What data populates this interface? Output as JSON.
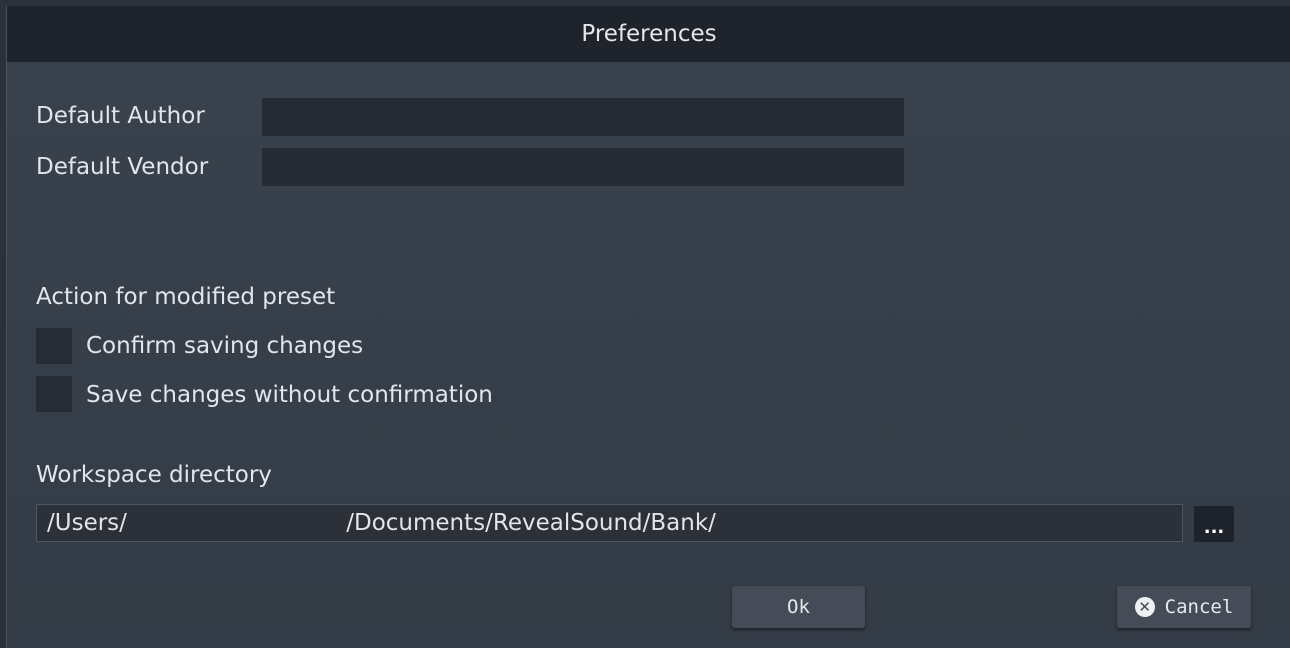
{
  "dialog": {
    "title": "Preferences"
  },
  "fields": {
    "author_label": "Default Author",
    "author_value": "",
    "vendor_label": "Default Vendor",
    "vendor_value": ""
  },
  "modified_preset": {
    "heading": "Action for modified preset",
    "option_confirm": "Confirm saving changes",
    "option_confirm_checked": false,
    "option_auto_save": "Save changes without confirmation",
    "option_auto_save_checked": false
  },
  "workspace": {
    "label": "Workspace directory",
    "path": "/Users/                              /Documents/RevealSound/Bank/",
    "browse_label": "..."
  },
  "buttons": {
    "ok": "Ok",
    "cancel": "Cancel",
    "cancel_icon": "close-circle-icon"
  }
}
